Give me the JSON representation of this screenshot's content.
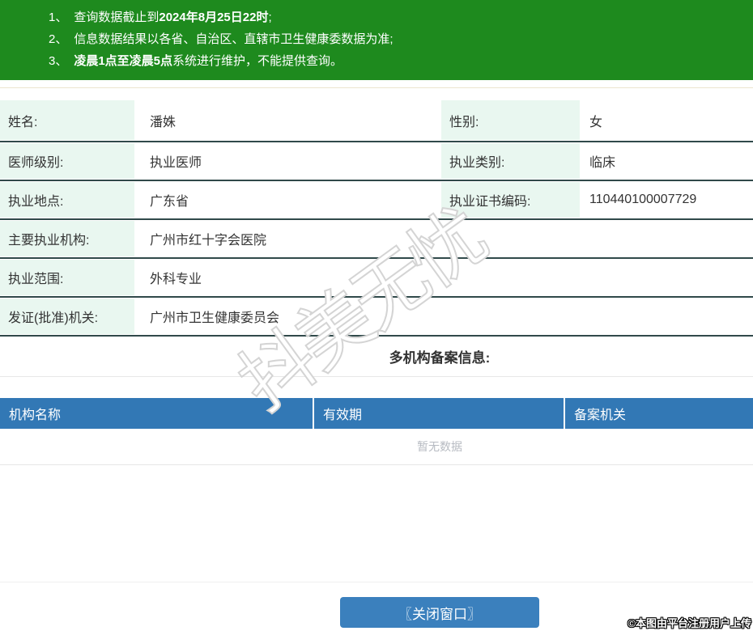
{
  "notice": {
    "items": [
      {
        "num": "1、",
        "pre": "查询数据截止到",
        "bold": "2024年8月25日22时",
        "post": ";"
      },
      {
        "num": "2、",
        "pre": "信息数据结果以各省、自治区、直辖市卫生健康委数据为准;",
        "bold": "",
        "post": ""
      },
      {
        "num": "3、",
        "pre": "",
        "bold": "凌晨1点至凌晨5点",
        "post": "系统进行维护，不能提供查询。"
      }
    ]
  },
  "info": {
    "rows": [
      {
        "label": "姓名:",
        "value": "潘姝",
        "label2": "性别:",
        "value2": "女"
      },
      {
        "label": "医师级别:",
        "value": "执业医师",
        "label2": "执业类别:",
        "value2": "临床"
      },
      {
        "label": "执业地点:",
        "value": "广东省",
        "label2": "执业证书编码:",
        "value2": "110440100007729"
      },
      {
        "label": "主要执业机构:",
        "value": "广州市红十字会医院"
      },
      {
        "label": "执业范围:",
        "value": "外科专业"
      },
      {
        "label": "发证(批准)机关:",
        "value": "广州市卫生健康委员会"
      }
    ]
  },
  "filing": {
    "title": "多机构备案信息:",
    "columns": [
      "机构名称",
      "有效期",
      "备案机关"
    ],
    "empty_text": "暂无数据"
  },
  "footer": {
    "close_button": "〖关闭窗口〗",
    "copyright": "©本图由平台注册用户上传"
  },
  "watermark": {
    "text": "抖美无忧"
  },
  "colors": {
    "notice_green": "#1e8a1e",
    "label_mint": "#e9f7f0",
    "row_border_dark": "#30494a",
    "table_header_blue": "#3278b5",
    "button_blue": "#3b80bd",
    "empty_text_gray": "#b7bbc2"
  }
}
